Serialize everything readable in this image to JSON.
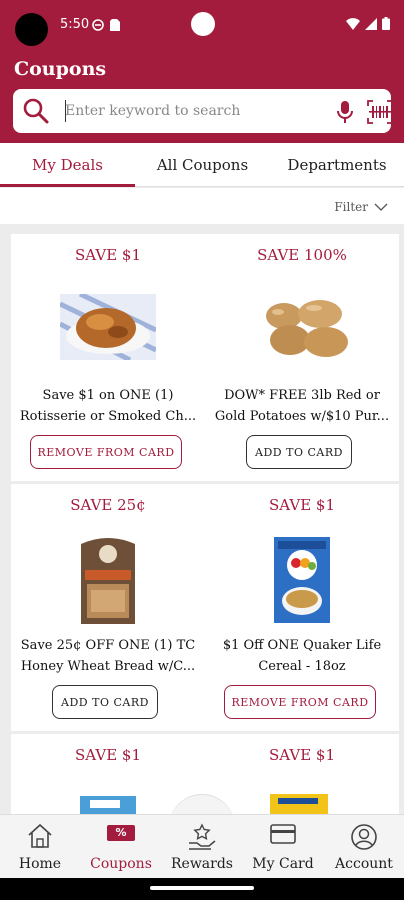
{
  "status": {
    "time": "5:50"
  },
  "page": {
    "title": "Coupons"
  },
  "search": {
    "placeholder": "Enter keyword to search"
  },
  "tabs": [
    {
      "label": "My Deals",
      "active": true
    },
    {
      "label": "All Coupons"
    },
    {
      "label": "Departments"
    }
  ],
  "filter": {
    "label": "Filter"
  },
  "coupons": [
    {
      "save": "SAVE $1",
      "line1": "Save $1 on ONE (1)",
      "line2": "Rotisserie or Smoked Ch...",
      "button": "REMOVE FROM CARD",
      "state": "remove",
      "image": "rotisserie-chicken"
    },
    {
      "save": "SAVE 100%",
      "line1": "DOW* FREE 3lb Red or",
      "line2": "Gold Potatoes w/$10 Pur...",
      "button": "ADD TO CARD",
      "state": "add",
      "image": "potatoes"
    },
    {
      "save": "SAVE 25¢",
      "line1": "Save 25¢ OFF ONE (1) TC",
      "line2": "Honey Wheat Bread w/C...",
      "button": "ADD TO CARD",
      "state": "add",
      "image": "wheat-bread"
    },
    {
      "save": "SAVE $1",
      "line1": "$1 Off ONE Quaker Life",
      "line2": "Cereal - 18oz",
      "button": "REMOVE FROM CARD",
      "state": "remove",
      "image": "life-cereal"
    },
    {
      "save": "SAVE $1",
      "image": "product-box-blue"
    },
    {
      "save": "SAVE $1",
      "image": "product-box-yellow"
    }
  ],
  "bottom_nav": [
    {
      "label": "Home",
      "icon": "home-icon"
    },
    {
      "label": "Coupons",
      "icon": "coupon-icon",
      "active": true,
      "icon_text": "%"
    },
    {
      "label": "Rewards",
      "icon": "rewards-icon"
    },
    {
      "label": "My Card",
      "icon": "card-icon"
    },
    {
      "label": "Account",
      "icon": "account-icon"
    }
  ],
  "colors": {
    "brand": "#a31c3d",
    "background": "#ececec"
  }
}
